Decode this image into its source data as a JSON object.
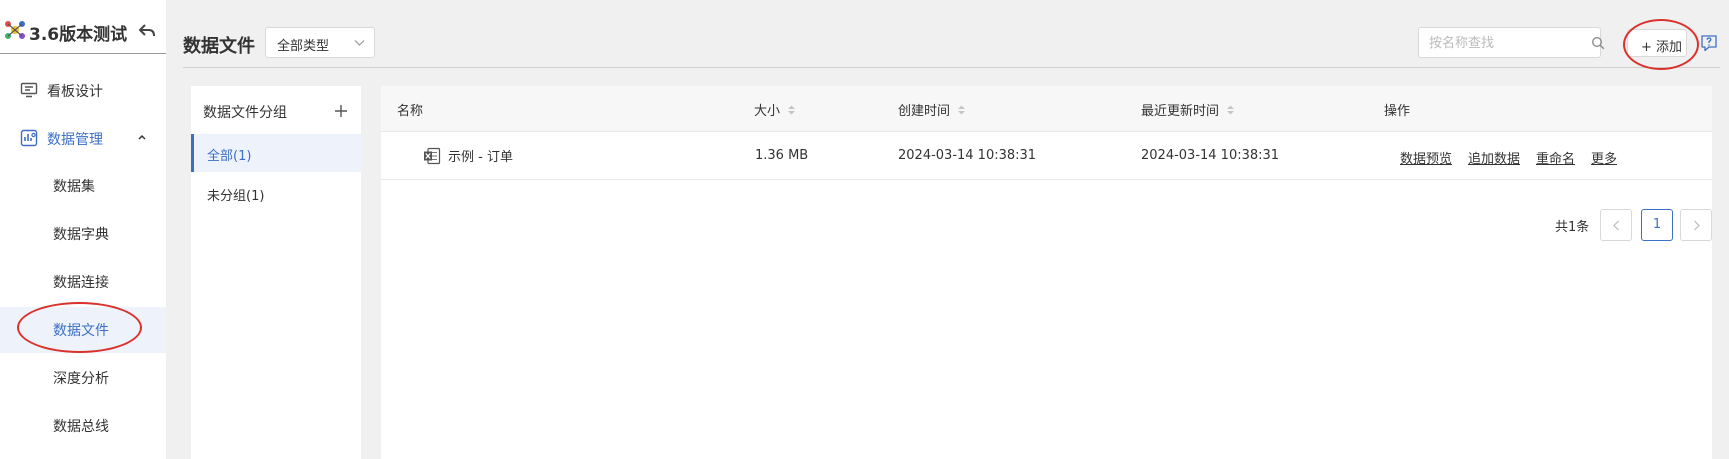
{
  "sidebar": {
    "brand": {
      "title": "3.6版本测试"
    },
    "nav": [
      {
        "label": "看板设计",
        "icon": "monitor-icon"
      },
      {
        "label": "数据管理",
        "icon": "data-management-icon",
        "expanded": true
      }
    ],
    "sub_items": [
      {
        "label": "数据集"
      },
      {
        "label": "数据字典"
      },
      {
        "label": "数据连接"
      },
      {
        "label": "数据文件",
        "active": true
      },
      {
        "label": "深度分析"
      },
      {
        "label": "数据总线"
      }
    ]
  },
  "header": {
    "title": "数据文件",
    "type_select": {
      "value": "全部类型"
    },
    "search": {
      "placeholder": "按名称查找"
    },
    "add_button": "+ 添加"
  },
  "groups": {
    "title": "数据文件分组",
    "items": [
      {
        "label": "全部(1)",
        "active": true
      },
      {
        "label": "未分组(1)"
      }
    ]
  },
  "table": {
    "columns": [
      "名称",
      "大小",
      "创建时间",
      "最近更新时间",
      "操作"
    ],
    "rows": [
      {
        "name": "示例 - 订单",
        "size": "1.36 MB",
        "created": "2024-03-14 10:38:31",
        "updated": "2024-03-14 10:38:31",
        "actions": [
          "数据预览",
          "追加数据",
          "重命名",
          "更多"
        ]
      }
    ]
  },
  "pagination": {
    "total": "共1条",
    "current_page": "1"
  },
  "colors": {
    "accent": "#3d6fc5",
    "annotation": "#d9312b",
    "backdrop": "#f0f0f0"
  }
}
